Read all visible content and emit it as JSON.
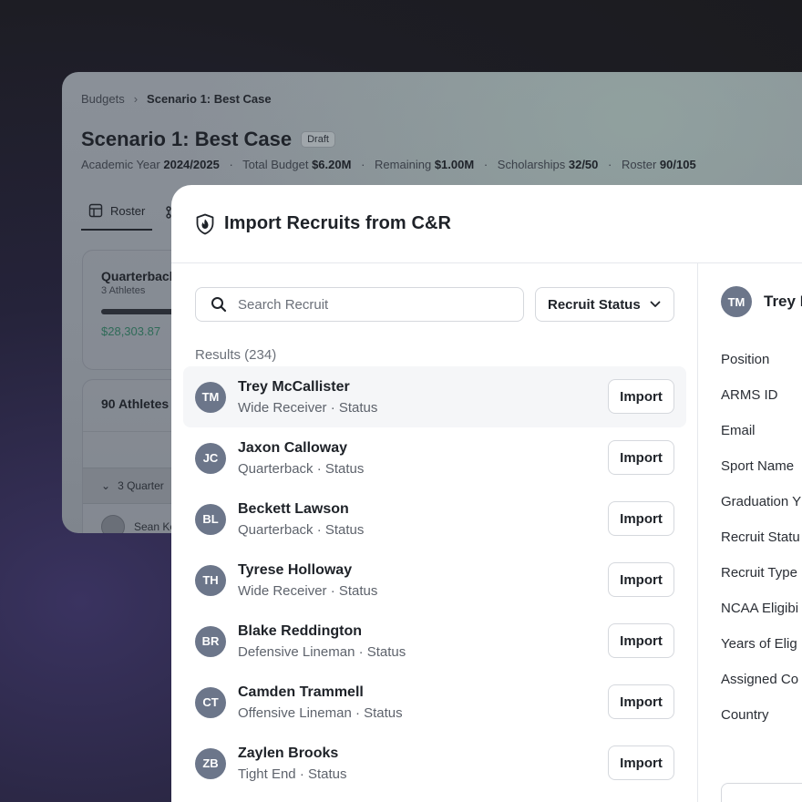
{
  "background_app": {
    "breadcrumb": {
      "parent": "Budgets",
      "current": "Scenario 1: Best Case"
    },
    "title": "Scenario 1: Best Case",
    "status_badge": "Draft",
    "meta": {
      "academic_year_label": "Academic Year",
      "academic_year_value": "2024/2025",
      "total_budget_label": "Total Budget",
      "total_budget_value": "$6.20M",
      "remaining_label": "Remaining",
      "remaining_value": "$1.00M",
      "scholarships_label": "Scholarships",
      "scholarships_value": "32/50",
      "roster_label": "Roster",
      "roster_value": "90/105"
    },
    "tabs": [
      {
        "label": "Roster",
        "icon": "table-icon"
      },
      {
        "label": "",
        "icon": "hierarchy-icon"
      }
    ],
    "position_card": {
      "title": "Quarterback",
      "subtitle": "3 Athletes",
      "amount": "$28,303.87"
    },
    "athletes_card": {
      "title": "90 Athletes",
      "group_label": "3 Quarter",
      "person_name": "Sean Ke"
    }
  },
  "modal": {
    "title": "Import Recruits from C&R",
    "icon": "shield-logo-icon",
    "search": {
      "placeholder": "Search Recruit",
      "value": ""
    },
    "status_filter": {
      "label": "Recruit Status"
    },
    "results_label": "Results (234)",
    "import_label": "Import",
    "recruits": [
      {
        "initials": "TM",
        "name": "Trey McCallister",
        "subtitle": "Wide Receiver · Status"
      },
      {
        "initials": "JC",
        "name": "Jaxon Calloway",
        "subtitle": "Quarterback · Status"
      },
      {
        "initials": "BL",
        "name": "Beckett Lawson",
        "subtitle": "Quarterback · Status"
      },
      {
        "initials": "TH",
        "name": "Tyrese Holloway",
        "subtitle": "Wide Receiver · Status"
      },
      {
        "initials": "BR",
        "name": "Blake Reddington",
        "subtitle": "Defensive Lineman · Status"
      },
      {
        "initials": "CT",
        "name": "Camden Trammell",
        "subtitle": "Offensive Lineman · Status"
      },
      {
        "initials": "ZB",
        "name": "Zaylen Brooks",
        "subtitle": "Tight End · Status"
      }
    ],
    "detail": {
      "initials": "TM",
      "name": "Trey I",
      "fields": [
        "Position",
        "ARMS ID",
        "Email",
        "Sport Name",
        "Graduation Y",
        "Recruit Statu",
        "Recruit Type",
        "NCAA Eligibi",
        "Years of Elig",
        "Assigned Co",
        "Country"
      ]
    }
  }
}
